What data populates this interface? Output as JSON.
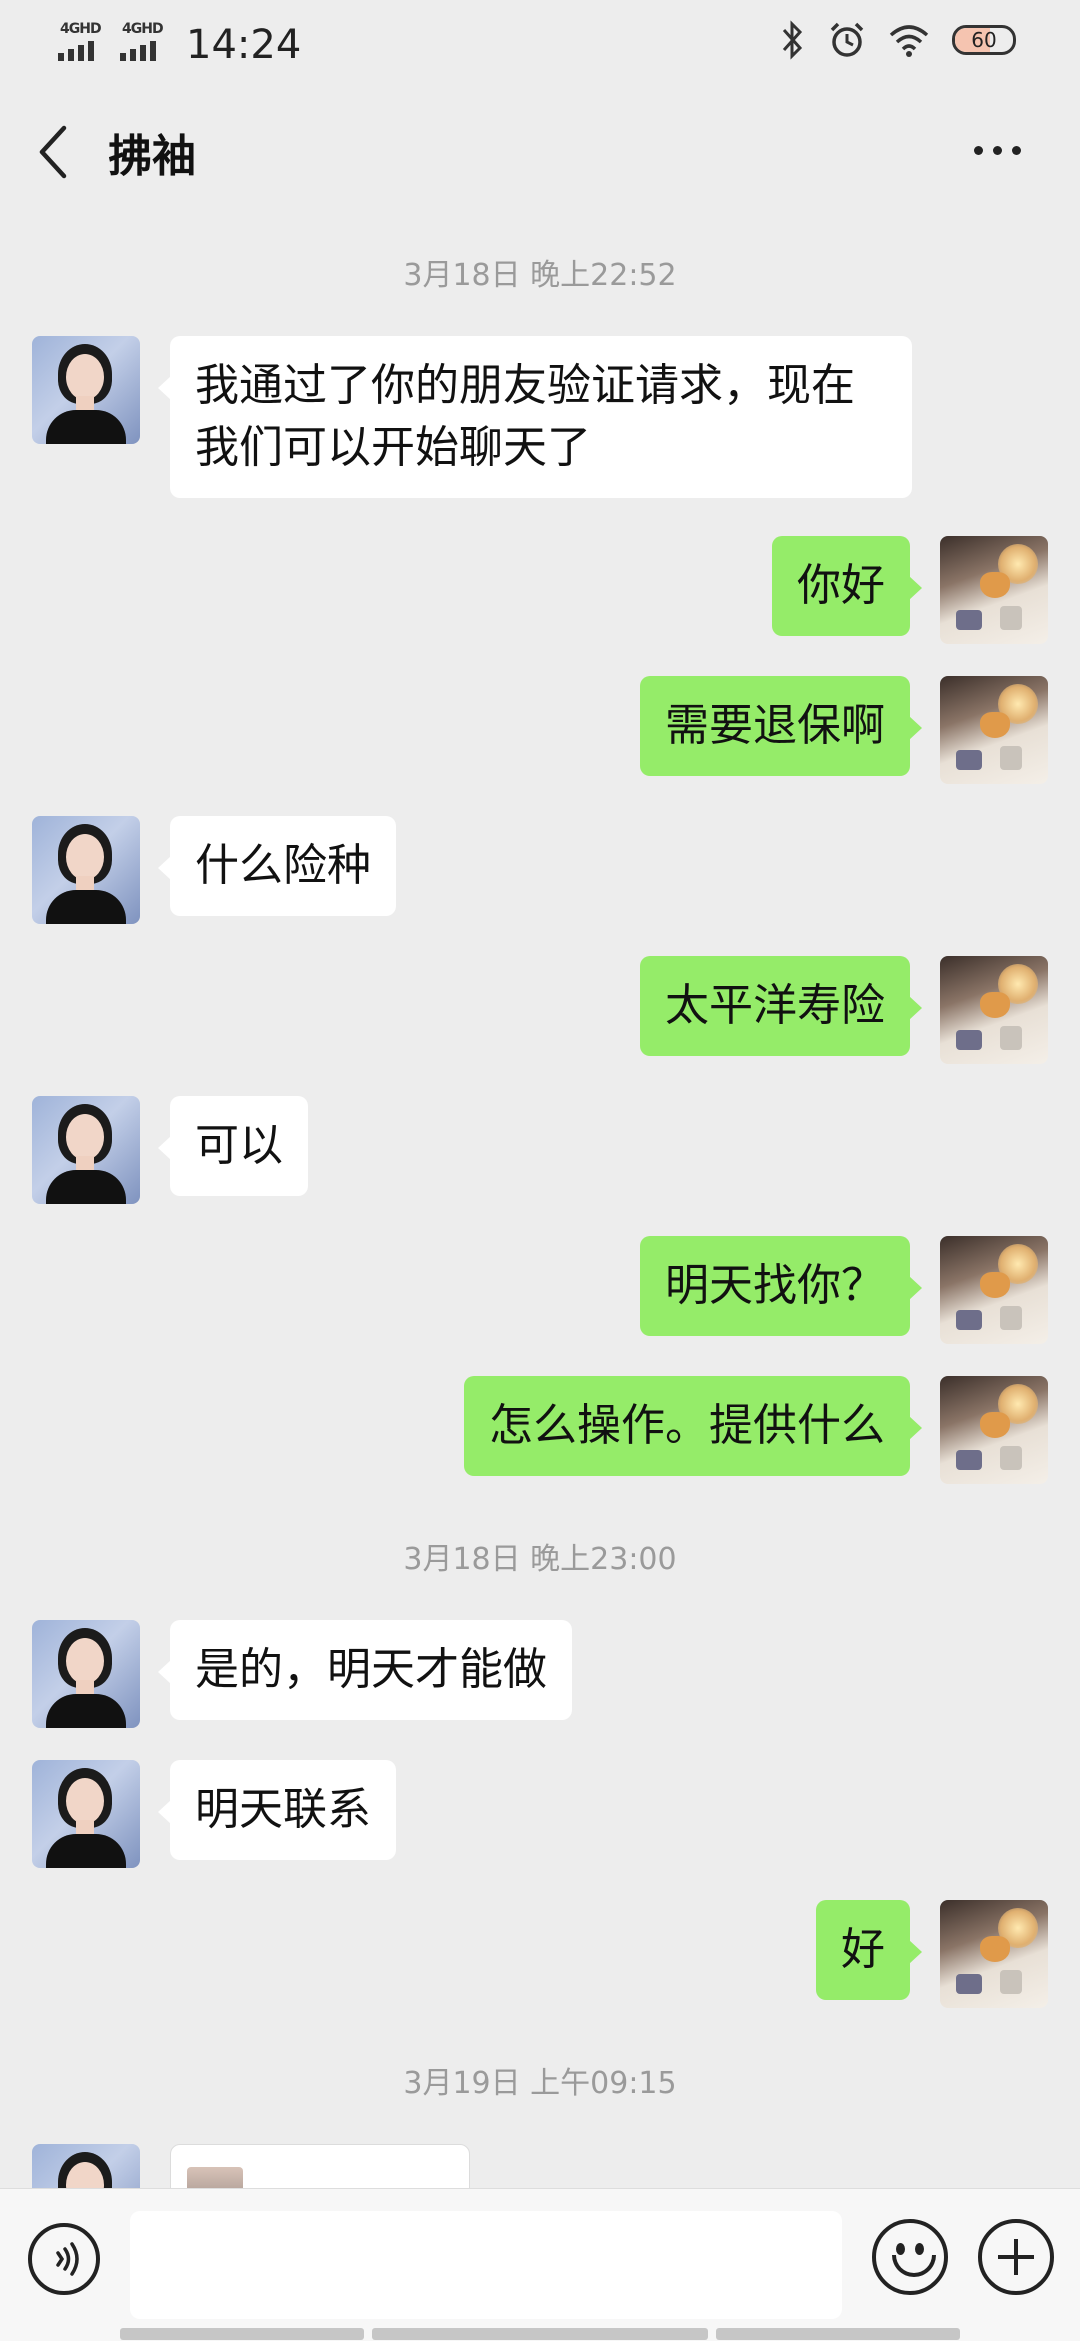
{
  "status_bar": {
    "network_1": "4GHD",
    "network_2": "4GHD",
    "time": "14:24",
    "battery": "60",
    "icons": [
      "bluetooth-icon",
      "alarm-icon",
      "wifi-icon",
      "battery-icon"
    ]
  },
  "header": {
    "title": "拂袖",
    "back_icon": "chevron-left-icon",
    "more_icon": "more-dots-icon"
  },
  "chat": {
    "timestamps": [
      "3月18日 晚上22:52",
      "3月18日 晚上23:00",
      "3月19日 上午09:15"
    ],
    "messages": [
      {
        "from": "them",
        "text_lines": [
          "我通过了你的朋友验证请求，现在",
          "我们可以开始聊天了"
        ]
      },
      {
        "from": "me",
        "text": "你好"
      },
      {
        "from": "me",
        "text": "需要退保啊"
      },
      {
        "from": "them",
        "text": "什么险种"
      },
      {
        "from": "me",
        "text": "太平洋寿险"
      },
      {
        "from": "them",
        "text": "可以"
      },
      {
        "from": "me",
        "text": "明天找你？"
      },
      {
        "from": "me",
        "text": "怎么操作。提供什么"
      },
      {
        "from": "them",
        "text": "是的，明天才能做"
      },
      {
        "from": "them",
        "text": "明天联系"
      },
      {
        "from": "me",
        "text": "好"
      }
    ]
  },
  "input_bar": {
    "voice_icon": "voice-input-icon",
    "emoji_icon": "emoji-icon",
    "plus_icon": "plus-circle-icon",
    "input_value": ""
  },
  "colors": {
    "background": "#ededed",
    "outgoing_bubble": "#95ec69",
    "incoming_bubble": "#ffffff",
    "timestamp": "#9a9a9a"
  }
}
